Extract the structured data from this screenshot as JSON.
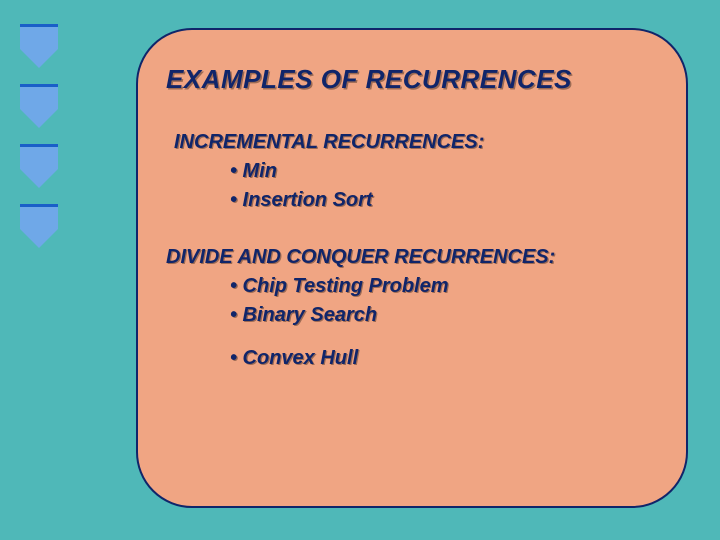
{
  "slide": {
    "title": "EXAMPLES OF RECURRENCES",
    "section1": {
      "heading": "INCREMENTAL RECURRENCES:",
      "items": [
        "• Min",
        "• Insertion Sort"
      ]
    },
    "section2": {
      "heading": "DIVIDE AND CONQUER RECURRENCES:",
      "items": [
        "• Chip Testing Problem",
        "• Binary Search",
        "• Convex Hull"
      ]
    }
  }
}
